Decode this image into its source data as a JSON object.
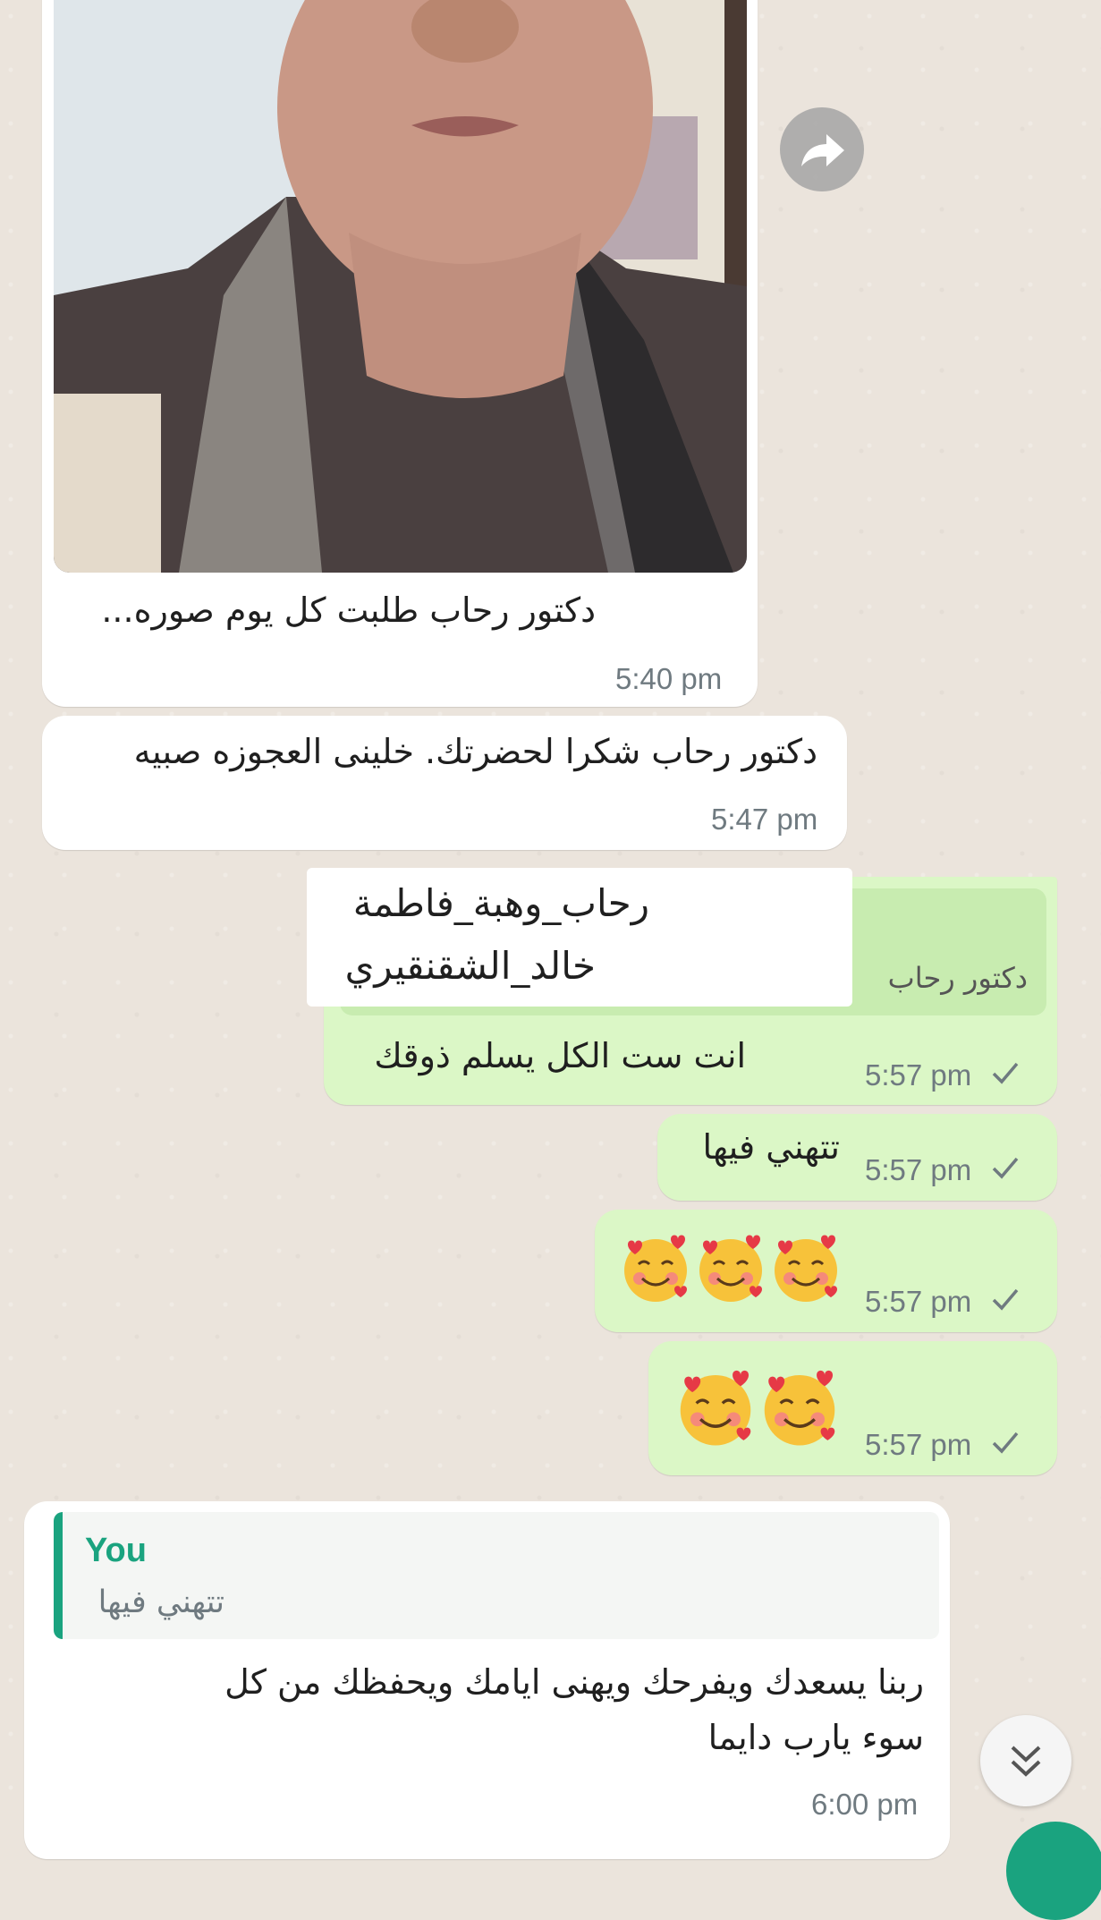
{
  "messages": {
    "photo_caption": "دكتور رحاب طلبت كل يوم صوره...",
    "photo_time": "5:40 pm",
    "thanks_text": "دكتور رحاب شكرا لحضرتك. خلينى العجوزه صبيه",
    "thanks_time": "5:47 pm",
    "overlay_line1": "رحاب_وهبة_فاطمة",
    "overlay_line2": "خالد_الشقنقيري",
    "reply_sender_partial": "دكتور رحاب",
    "reply_text": "انت ست الكل يسلم ذوقك",
    "reply_time": "5:57 pm",
    "enjoy_text": "تتهني فيها",
    "enjoy_time": "5:57 pm",
    "emoji3_time": "5:57 pm",
    "emoji2_time": "5:57 pm",
    "quote_author": "You",
    "quote_text": "تتهني فيها",
    "last_line1": "ربنا  يسعدك ويفرحك ويهنى ايامك ويحفظك من كل",
    "last_line2": "سوء يارب دايما",
    "last_time": "6:00 pm"
  },
  "colors": {
    "incoming_bubble": "#ffffff",
    "outgoing_bubble": "#dbf7c6",
    "quote_accent": "#1aa37f",
    "tick": "#6f7a80"
  },
  "icons": {
    "forward": "forward-arrow-icon",
    "read_tick": "single-check-icon",
    "scroll_down": "double-chevron-down-icon",
    "emoji": "smiling-face-with-hearts-emoji"
  }
}
